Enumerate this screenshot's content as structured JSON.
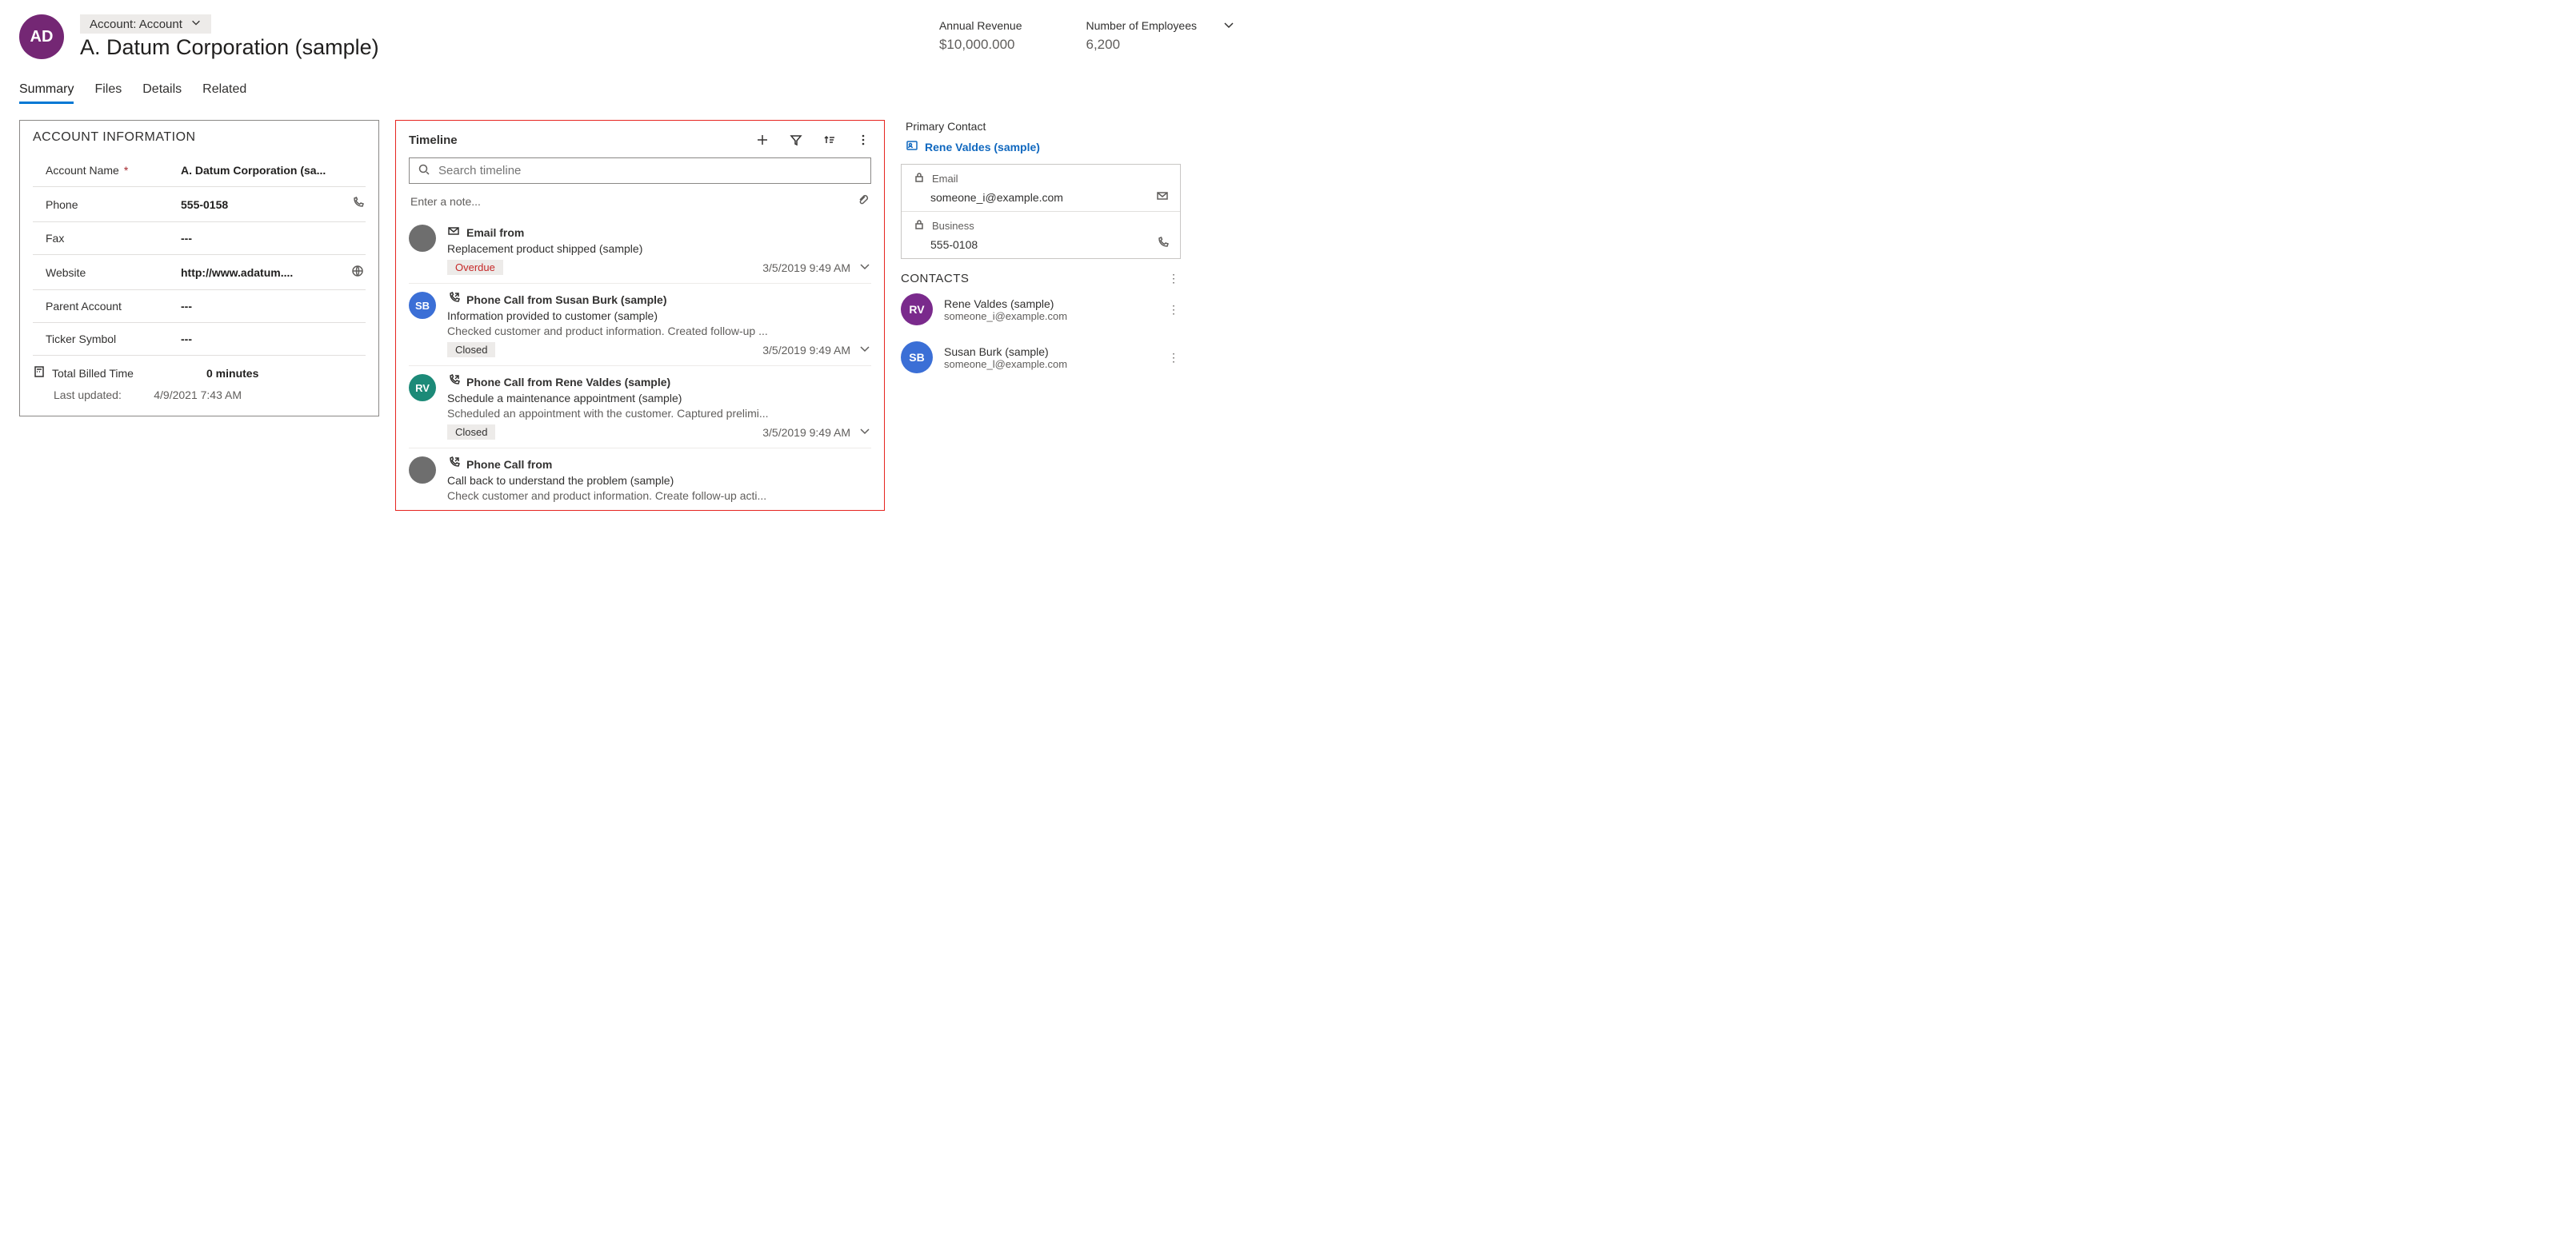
{
  "header": {
    "avatar_initials": "AD",
    "entity_label": "Account: Account",
    "record_title": "A. Datum Corporation (sample)",
    "stats": [
      {
        "label": "Annual Revenue",
        "value": "$10,000.000"
      },
      {
        "label": "Number of Employees",
        "value": "6,200"
      }
    ]
  },
  "tabs": [
    "Summary",
    "Files",
    "Details",
    "Related"
  ],
  "active_tab": "Summary",
  "account_info": {
    "section_title": "ACCOUNT INFORMATION",
    "fields": {
      "account_name": {
        "label": "Account Name",
        "value": "A. Datum Corporation (sa...",
        "required": true
      },
      "phone": {
        "label": "Phone",
        "value": "555-0158"
      },
      "fax": {
        "label": "Fax",
        "value": "---"
      },
      "website": {
        "label": "Website",
        "value": "http://www.adatum...."
      },
      "parent": {
        "label": "Parent Account",
        "value": "---"
      },
      "ticker": {
        "label": "Ticker Symbol",
        "value": "---"
      }
    },
    "billed": {
      "label": "Total Billed Time",
      "value": "0 minutes"
    },
    "updated": {
      "label": "Last updated:",
      "value": "4/9/2021 7:43 AM"
    }
  },
  "timeline": {
    "title": "Timeline",
    "search_placeholder": "Search timeline",
    "note_placeholder": "Enter a note...",
    "items": [
      {
        "icon": "email",
        "title": "Email from",
        "subtitle": "Replacement product shipped (sample)",
        "description": "",
        "badge": "Overdue",
        "badge_color": "red",
        "time": "3/5/2019 9:49 AM",
        "avatar_initials": "",
        "avatar_color": "#6e6e6e"
      },
      {
        "icon": "phone-out",
        "title": "Phone Call from Susan Burk (sample)",
        "subtitle": "Information provided to customer (sample)",
        "description": "Checked customer and product information. Created follow-up ...",
        "badge": "Closed",
        "badge_color": "grey",
        "time": "3/5/2019 9:49 AM",
        "avatar_initials": "SB",
        "avatar_color": "#3b6fd6"
      },
      {
        "icon": "phone-out",
        "title": "Phone Call from Rene Valdes (sample)",
        "subtitle": "Schedule a maintenance appointment (sample)",
        "description": "Scheduled an appointment with the customer. Captured prelimi...",
        "badge": "Closed",
        "badge_color": "grey",
        "time": "3/5/2019 9:49 AM",
        "avatar_initials": "RV",
        "avatar_color": "#1c8a78"
      },
      {
        "icon": "phone-out",
        "title": "Phone Call from",
        "subtitle": "Call back to understand the problem (sample)",
        "description": "Check customer and product information. Create follow-up acti...",
        "badge": "",
        "badge_color": "",
        "time": "",
        "avatar_initials": "",
        "avatar_color": "#6e6e6e"
      }
    ]
  },
  "primary_contact": {
    "label": "Primary Contact",
    "name": "Rene Valdes (sample)",
    "email_label": "Email",
    "email": "someone_i@example.com",
    "business_label": "Business",
    "business": "555-0108"
  },
  "contacts": {
    "title": "CONTACTS",
    "items": [
      {
        "initials": "RV",
        "color": "#7a2a8c",
        "name": "Rene Valdes (sample)",
        "email": "someone_i@example.com"
      },
      {
        "initials": "SB",
        "color": "#3b6fd6",
        "name": "Susan Burk (sample)",
        "email": "someone_l@example.com"
      }
    ]
  }
}
